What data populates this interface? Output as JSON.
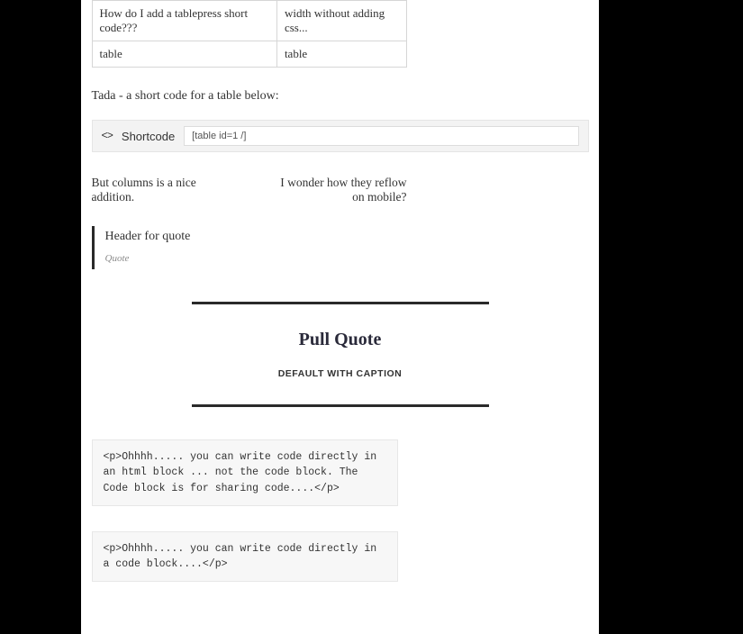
{
  "table": {
    "rows": [
      [
        "How do I add a tablepress short code???",
        "width without adding css..."
      ],
      [
        "table",
        "table"
      ]
    ]
  },
  "tada_text": "Tada - a short code for a table below:",
  "shortcode": {
    "icon_glyph": "<>",
    "label": "Shortcode",
    "value": "[table id=1 /]"
  },
  "columns": {
    "left": "But columns is a nice addition.",
    "right": "I wonder how they reflow on mobile?"
  },
  "quote": {
    "header": "Header for quote",
    "caption": "Quote"
  },
  "pullquote": {
    "title": "Pull Quote",
    "caption": "DEFAULT WITH CAPTION"
  },
  "code1": "<p>Ohhhh..... you can write code directly in an html block ... not the code block. The Code block is for sharing code....</p>",
  "code2": "<p>Ohhhh..... you can write code directly in a code block....</p>"
}
